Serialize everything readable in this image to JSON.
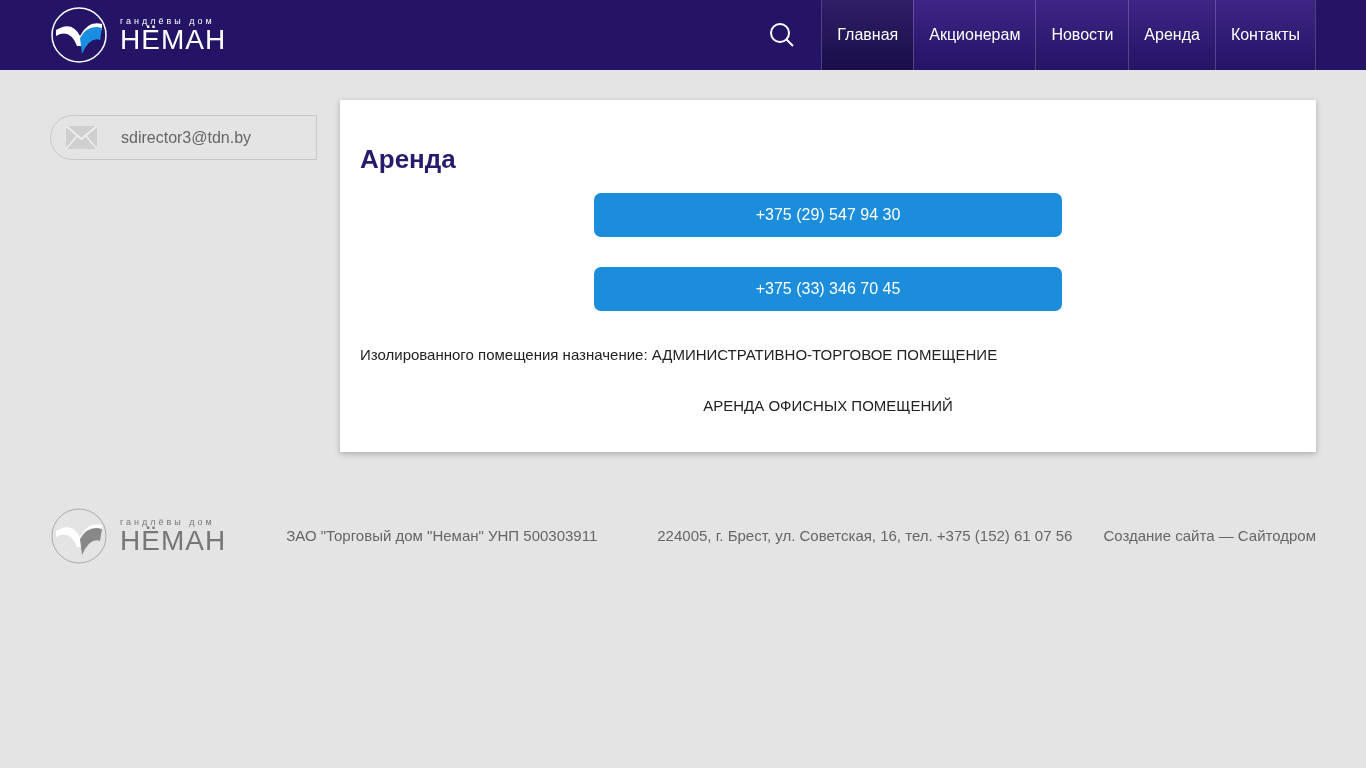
{
  "header": {
    "logo": {
      "tagline": "гандлёвы дом",
      "name": "НЁМАН"
    },
    "nav": [
      {
        "label": "Главная",
        "selected": true
      },
      {
        "label": "Акционерам",
        "selected": false
      },
      {
        "label": "Новости",
        "selected": false
      },
      {
        "label": "Аренда",
        "selected": false
      },
      {
        "label": "Контакты",
        "selected": false
      }
    ]
  },
  "sidebar": {
    "email": "sdirector3@tdn.by"
  },
  "content": {
    "title": "Аренда",
    "phones": [
      "+375 (29) 547 94 30",
      "+375 (33) 346 70 45"
    ],
    "description": "Изолированного помещения назначение: АДМИНИСТРАТИВНО-ТОРГОВОЕ ПОМЕЩЕНИЕ",
    "subtitle": "АРЕНДА ОФИСНЫХ ПОМЕЩЕНИЙ"
  },
  "footer": {
    "logo": {
      "tagline": "гандлёвы дом",
      "name": "НЁМАН"
    },
    "company": "ЗАО \"Торговый дом \"Неман\" УНП 500303911",
    "address": "224005, г. Брест, ул. Советская, 16, тел. +375 (152) 61 07 56",
    "credit": "Создание сайта — Сайтодром"
  }
}
